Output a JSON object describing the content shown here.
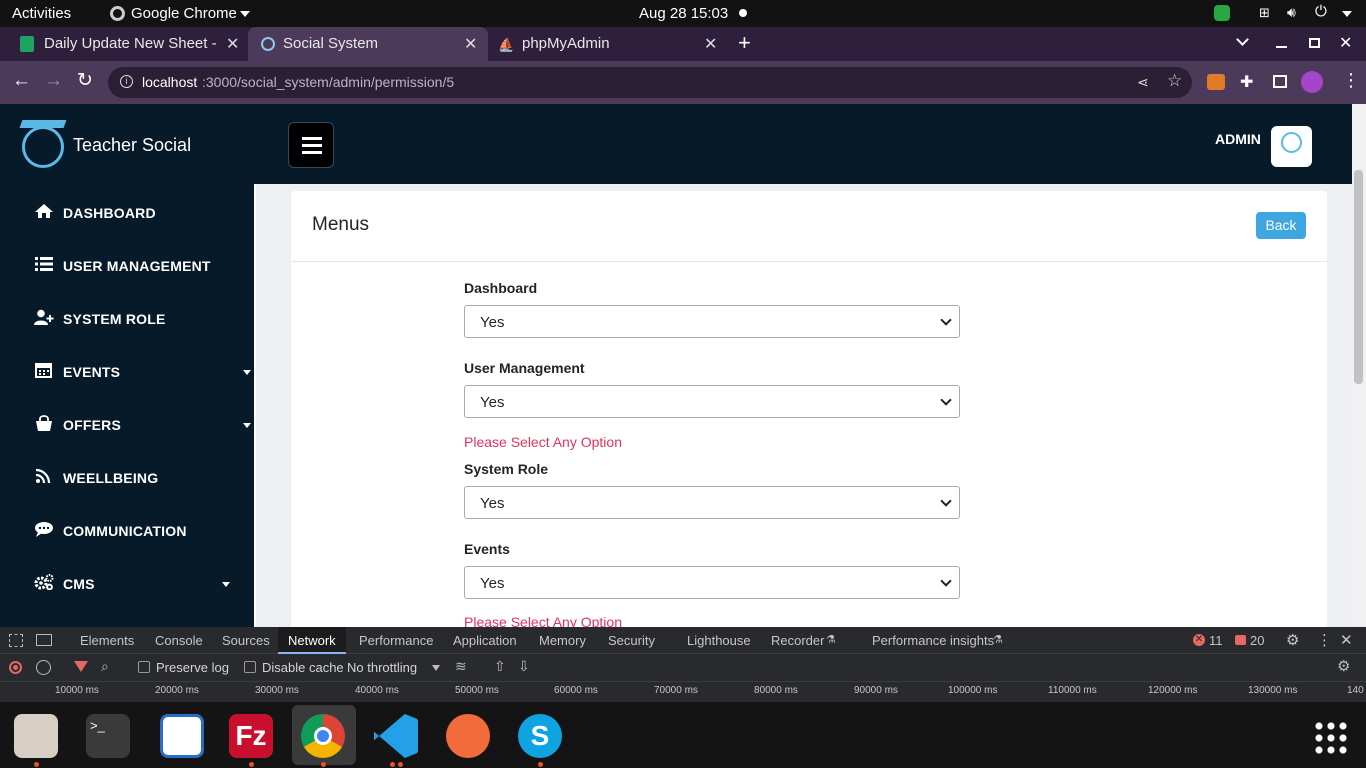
{
  "topbar": {
    "activities": "Activities",
    "app": "Google Chrome",
    "datetime": "Aug 28  15:03"
  },
  "tabs": [
    {
      "title": "Daily Update New Sheet - "
    },
    {
      "title": "Social System"
    },
    {
      "title": "phpMyAdmin"
    }
  ],
  "address": {
    "host": "localhost",
    "path": ":3000/social_system/admin/permission/5"
  },
  "header": {
    "brand": "Teacher Social",
    "user": "ADMIN"
  },
  "sidebar": {
    "items": [
      {
        "label": "DASHBOARD",
        "icon": "home-icon"
      },
      {
        "label": "USER MANAGEMENT",
        "icon": "list-icon"
      },
      {
        "label": "SYSTEM ROLE",
        "icon": "user-plus-icon"
      },
      {
        "label": "EVENTS",
        "icon": "calendar-icon"
      },
      {
        "label": "OFFERS",
        "icon": "shopping-bag-icon"
      },
      {
        "label": "WEELLBEING",
        "icon": "rss-icon"
      },
      {
        "label": "COMMUNICATION",
        "icon": "chat-icon"
      },
      {
        "label": "CMS",
        "icon": "gears-icon"
      }
    ]
  },
  "card": {
    "title": "Menus",
    "back_label": "Back"
  },
  "form": {
    "fields": [
      {
        "label": "Dashboard",
        "value": "Yes"
      },
      {
        "label": "User Management",
        "value": "Yes",
        "error": "Please Select Any Option"
      },
      {
        "label": "System Role",
        "value": "Yes"
      },
      {
        "label": "Events",
        "value": "Yes",
        "error": "Please Select Any Option"
      }
    ]
  },
  "devtools": {
    "tabs": [
      "Elements",
      "Console",
      "Sources",
      "Network",
      "Performance",
      "Application",
      "Memory",
      "Security",
      "Lighthouse",
      "Recorder",
      "Performance insights"
    ],
    "active_tab": "Network",
    "errors": "11",
    "issues": "20",
    "preserve_log": "Preserve log",
    "disable_cache": "Disable cache",
    "throttling": "No throttling",
    "timeline": [
      "10000 ms",
      "20000 ms",
      "30000 ms",
      "40000 ms",
      "50000 ms",
      "60000 ms",
      "70000 ms",
      "80000 ms",
      "90000 ms",
      "100000 ms",
      "110000 ms",
      "120000 ms",
      "130000 ms",
      "140"
    ]
  },
  "dock": {
    "apps": [
      "files",
      "terminal",
      "text-editor",
      "filezilla",
      "chrome",
      "vscode",
      "postman",
      "skype"
    ]
  },
  "colors": {
    "sidebar_bg": "#071a2a",
    "accent": "#3fa6df",
    "error": "#e0345c",
    "chrome_frame": "#4b3a5a"
  }
}
